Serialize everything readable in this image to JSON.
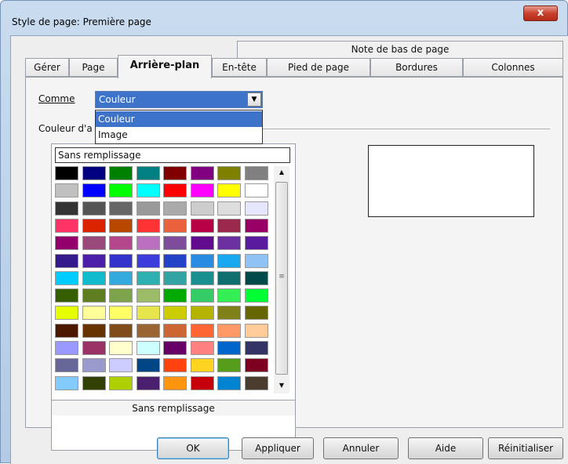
{
  "window": {
    "title": "Style de page: Première page",
    "close_label": "x"
  },
  "tabs": {
    "top_row": "Note de bas de page",
    "items": [
      "Gérer",
      "Page",
      "Arrière-plan",
      "En-tête",
      "Pied de page",
      "Bordures",
      "Colonnes"
    ],
    "active": "Arrière-plan"
  },
  "background": {
    "comme_label": "Comme",
    "comme_value": "Couleur",
    "options": [
      "Couleur",
      "Image"
    ],
    "selected_option": "Couleur",
    "couleur_label": "Couleur d'a",
    "fill_field": "Sans remplissage",
    "palette_footer": "Sans remplissage",
    "palette": [
      [
        "#000000",
        "#000080",
        "#008000",
        "#008080",
        "#800000",
        "#800080",
        "#808000",
        "#808080"
      ],
      [
        "#c0c0c0",
        "#0000ff",
        "#00ff00",
        "#00ffff",
        "#ff0000",
        "#ff00ff",
        "#ffff00",
        "#ffffff"
      ],
      [
        "#333333",
        "#555555",
        "#666666",
        "#999999",
        "#aaaaaa",
        "#cccccc",
        "#dddddd",
        "#e6e6ff"
      ],
      [
        "#ff3366",
        "#dc2300",
        "#b84700",
        "#ff3333",
        "#eb613d",
        "#b80047",
        "#99284c",
        "#990066"
      ],
      [
        "#94006b",
        "#994a7a",
        "#b4468c",
        "#bb6fbf",
        "#7d4c9a",
        "#630b8e",
        "#6b2fa0",
        "#5b1b9e"
      ],
      [
        "#351a8c",
        "#4b1fa8",
        "#3333cc",
        "#3d3ddb",
        "#2342c8",
        "#2a8be3",
        "#1aa8f0",
        "#90c2f5"
      ],
      [
        "#00ccff",
        "#11bbcc",
        "#33aadd",
        "#2fb0b0",
        "#33a3a3",
        "#1a8f8f",
        "#116e6e",
        "#004a4a"
      ],
      [
        "#355e00",
        "#5e7e21",
        "#7da44a",
        "#9cbb66",
        "#00aa00",
        "#33cc66",
        "#33ee55",
        "#00ff33"
      ],
      [
        "#e6ff00",
        "#ffff99",
        "#ffff66",
        "#e6e64c",
        "#cccc00",
        "#b3b300",
        "#808019",
        "#666600"
      ],
      [
        "#4c1900",
        "#663300",
        "#804c19",
        "#996633",
        "#cc6633",
        "#ff6633",
        "#ff9966",
        "#ffcc99"
      ],
      [
        "#9999ff",
        "#993366",
        "#ffffcc",
        "#ccffff",
        "#660066",
        "#ff8080",
        "#0066cc",
        "#333366"
      ],
      [
        "#666699",
        "#9999cc",
        "#ccccff",
        "#004586",
        "#ff420e",
        "#ffd320",
        "#579d1c",
        "#7e0021"
      ],
      [
        "#83caff",
        "#314004",
        "#aecf00",
        "#4b1f6f",
        "#ff950e",
        "#c5000b",
        "#0084d1",
        "#4c3c2e"
      ]
    ]
  },
  "buttons": {
    "ok": "OK",
    "apply": "Appliquer",
    "cancel": "Annuler",
    "help": "Aide",
    "reset": "Réinitialiser"
  }
}
